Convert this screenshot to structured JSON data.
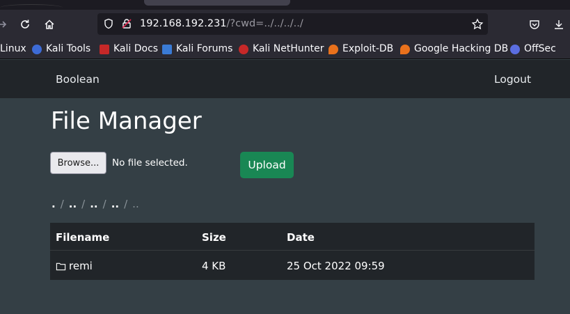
{
  "browser": {
    "url_host": "192.168.192.231",
    "url_path": "/?cwd=../../../../",
    "bookmarks": [
      {
        "label": "Linux",
        "icon": "kali-icon",
        "color": ""
      },
      {
        "label": "Kali Tools",
        "icon": "kali-tools-icon",
        "color": "#3d6bd6"
      },
      {
        "label": "Kali Docs",
        "icon": "kali-docs-icon",
        "color": "#d32f2f"
      },
      {
        "label": "Kali Forums",
        "icon": "kali-forums-icon",
        "color": "#3a7bd5"
      },
      {
        "label": "Kali NetHunter",
        "icon": "kali-nethunter-icon",
        "color": "#d32f2f"
      },
      {
        "label": "Exploit-DB",
        "icon": "exploit-db-icon",
        "color": "#e9711c"
      },
      {
        "label": "Google Hacking DB",
        "icon": "ghdb-icon",
        "color": "#e9711c"
      },
      {
        "label": "OffSec",
        "icon": "offsec-icon",
        "color": "#5b6ee1"
      }
    ]
  },
  "app": {
    "brand": "Boolean",
    "logout": "Logout",
    "title": "File Manager",
    "browse_label": "Browse...",
    "no_file": "No file selected.",
    "upload_label": "Upload",
    "breadcrumb": [
      ".",
      "..",
      "..",
      ".."
    ],
    "breadcrumb_active": "..",
    "table": {
      "headers": [
        "Filename",
        "Size",
        "Date"
      ],
      "rows": [
        {
          "name": "remi",
          "size": "4 KB",
          "date": "25 Oct 2022 09:59",
          "icon": "folder-icon"
        }
      ]
    }
  }
}
